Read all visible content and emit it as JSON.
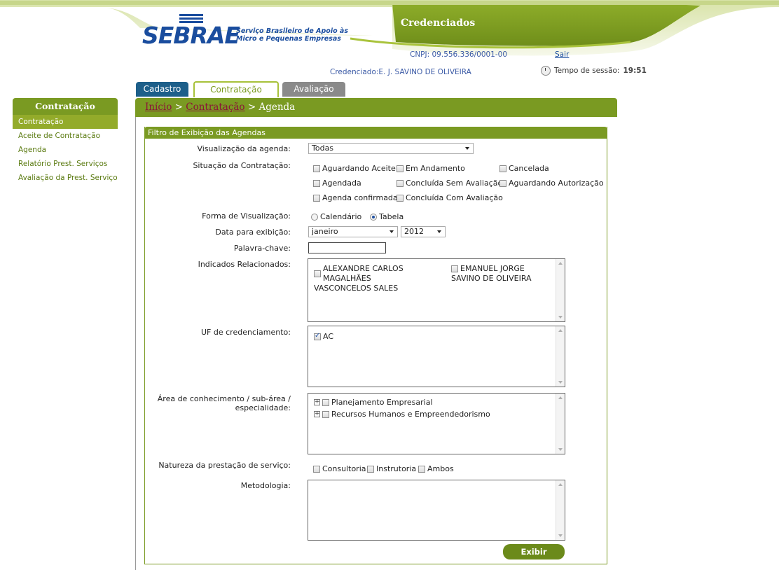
{
  "header": {
    "logo_text": "SEBRAE",
    "logo_sub_1": "Serviço Brasileiro de Apoio às",
    "logo_sub_2": "Micro e Pequenas Empresas",
    "title": "Credenciados",
    "cnpj": "CNPJ: 09.556.336/0001-00",
    "logout": "Sair",
    "credenciado": "Credenciado:E. J. SAVINO DE OLIVEIRA",
    "session_label": "Tempo de sessão:",
    "session_time": "19:51",
    "colors": {
      "brand_green": "#7a9a22",
      "brand_blue": "#1a4d9e"
    }
  },
  "tabs": [
    {
      "label": "Cadastro"
    },
    {
      "label": "Contratação"
    },
    {
      "label": "Avaliação"
    }
  ],
  "sidebar": {
    "title": "Contratação",
    "items": [
      {
        "label": "Contratação"
      },
      {
        "label": "Aceite de Contratação"
      },
      {
        "label": "Agenda"
      },
      {
        "label": "Relatório Prest. Serviços"
      },
      {
        "label": "Avaliação da Prest. Serviço"
      }
    ]
  },
  "breadcrumb": {
    "home": "Início",
    "sep": ">",
    "section": "Contratação",
    "current": "Agenda"
  },
  "filter": {
    "title": "Filtro de Exibição das Agendas",
    "visualizacao_label": "Visualização da agenda:",
    "visualizacao_value": "Todas",
    "situacao_label": "Situação da Contratação:",
    "situacao_options": [
      "Aguardando Aceite",
      "Em Andamento",
      "Cancelada",
      "Agendada",
      "Concluída Sem Avaliação",
      "Aguardando Autorização",
      "Agenda confirmada",
      "Concluída Com Avaliação"
    ],
    "forma_label": "Forma de Visualização:",
    "forma_options": [
      "Calendário",
      "Tabela"
    ],
    "forma_selected": "Tabela",
    "data_label": "Data para exibição:",
    "mes_value": "janeiro",
    "ano_value": "2012",
    "palavra_label": "Palavra-chave:",
    "palavra_value": "",
    "indicados_label": "Indicados Relacionados:",
    "indicados": [
      {
        "line1": "ALEXANDRE CARLOS MAGALHÃES",
        "line2": "VASCONCELOS SALES"
      },
      {
        "line1": "EMANUEL JORGE",
        "line2": "SAVINO DE OLIVEIRA"
      }
    ],
    "uf_label": "UF de credenciamento:",
    "uf_options": [
      {
        "label": "AC",
        "checked": true
      }
    ],
    "area_label_1": "Área de conhecimento / sub-área /",
    "area_label_2": "especialidade:",
    "areas": [
      "Planejamento Empresarial",
      "Recursos Humanos e Empreendedorismo"
    ],
    "natureza_label": "Natureza da prestação de serviço:",
    "natureza_options": [
      "Consultoria",
      "Instrutoria",
      "Ambos"
    ],
    "metodologia_label": "Metodologia:",
    "submit": "Exibir"
  }
}
